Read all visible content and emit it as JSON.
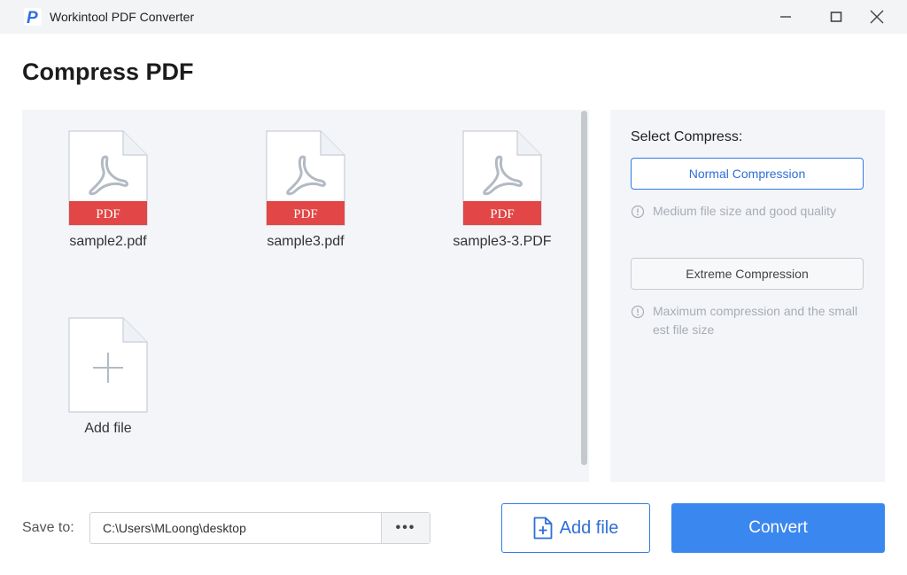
{
  "window": {
    "title": "Workintool PDF Converter",
    "logo_letter": "P",
    "controls": [
      "minimize-icon",
      "maximize-icon",
      "close-icon"
    ]
  },
  "page": {
    "title": "Compress PDF"
  },
  "files": [
    {
      "name": "sample2.pdf",
      "badge": "PDF"
    },
    {
      "name": "sample3.pdf",
      "badge": "PDF"
    },
    {
      "name": "sample3-3.PDF",
      "badge": "PDF"
    }
  ],
  "add_file_tile": {
    "label": "Add file"
  },
  "options": {
    "label": "Select Compress:",
    "normal": {
      "label": "Normal Compression",
      "hint": "Medium file size and good quality",
      "selected": true
    },
    "extreme": {
      "label": "Extreme Compression",
      "hint": "Maximum compression and the smallest file size",
      "selected": false
    }
  },
  "footer": {
    "save_label": "Save to:",
    "save_path": "C:\\Users\\MLoong\\desktop",
    "browse_label": "•••",
    "add_file_label": "Add file",
    "convert_label": "Convert"
  },
  "colors": {
    "accent": "#3b87f0",
    "pdf_badge": "#e24646",
    "panel_bg": "#f3f5f8"
  }
}
